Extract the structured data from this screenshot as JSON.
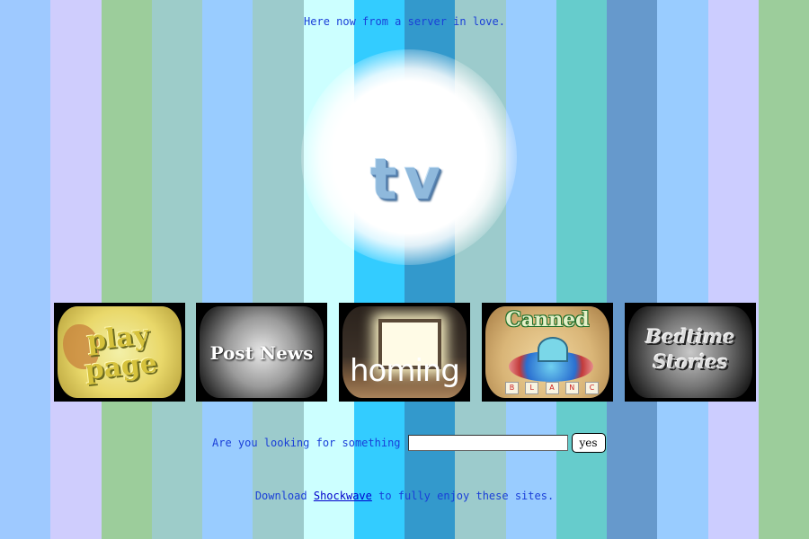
{
  "background_stripes": [
    "#9ec9ff",
    "#cfcdfd",
    "#9ccd9b",
    "#9dccc9",
    "#99ccff",
    "#9ccbcc",
    "#ccffff",
    "#33ccff",
    "#3399cc",
    "#9ccbcc",
    "#99ccff",
    "#66cccc",
    "#6699cc",
    "#99ccff",
    "#cccdff",
    "#9ccd9b"
  ],
  "tagline": "Here now from a server in love.",
  "logo": {
    "text": "tv"
  },
  "sites": [
    {
      "label": "play",
      "sub": "page",
      "icon": "play-thumbnail"
    },
    {
      "label": "Post News",
      "icon": "post-news-thumbnail"
    },
    {
      "label": "homing",
      "icon": "homing-thumbnail"
    },
    {
      "label": "Canned",
      "blocks": [
        "B",
        "L",
        "A",
        "N",
        "C"
      ],
      "icon": "canned-thumbnail"
    },
    {
      "label": "Bedtime",
      "sub": "Stories",
      "icon": "bedtime-stories-thumbnail"
    }
  ],
  "search": {
    "prompt": "Are you looking for something",
    "value": "",
    "button": "yes"
  },
  "footer": {
    "before": "Download",
    "link": "Shockwave",
    "after": "to fully enjoy these sites."
  }
}
